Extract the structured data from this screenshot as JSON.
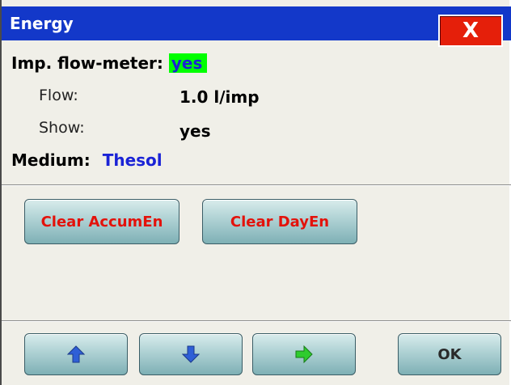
{
  "window": {
    "title": "Energy",
    "close_label": "X"
  },
  "settings": {
    "imp_flow_label": "Imp. flow-meter:",
    "imp_flow_value": "yes",
    "flow_label": "Flow:",
    "flow_value": "1.0 l/imp",
    "show_label": "Show:",
    "show_value": "yes",
    "medium_label": "Medium:",
    "medium_value": "Thesol"
  },
  "actions": {
    "clear_accum_label": "Clear AccumEn",
    "clear_day_label": "Clear DayEn"
  },
  "nav": {
    "up_icon": "arrow-up-icon",
    "down_icon": "arrow-down-icon",
    "right_icon": "arrow-right-icon",
    "ok_label": "OK"
  },
  "colors": {
    "titlebar": "#1338c9",
    "close": "#e51f0a",
    "highlight": "#00ff00",
    "value_blue": "#1a23d6",
    "action_red": "#e3120b",
    "arrow_blue": "#2f5fd6",
    "arrow_green": "#2fcc2f"
  }
}
